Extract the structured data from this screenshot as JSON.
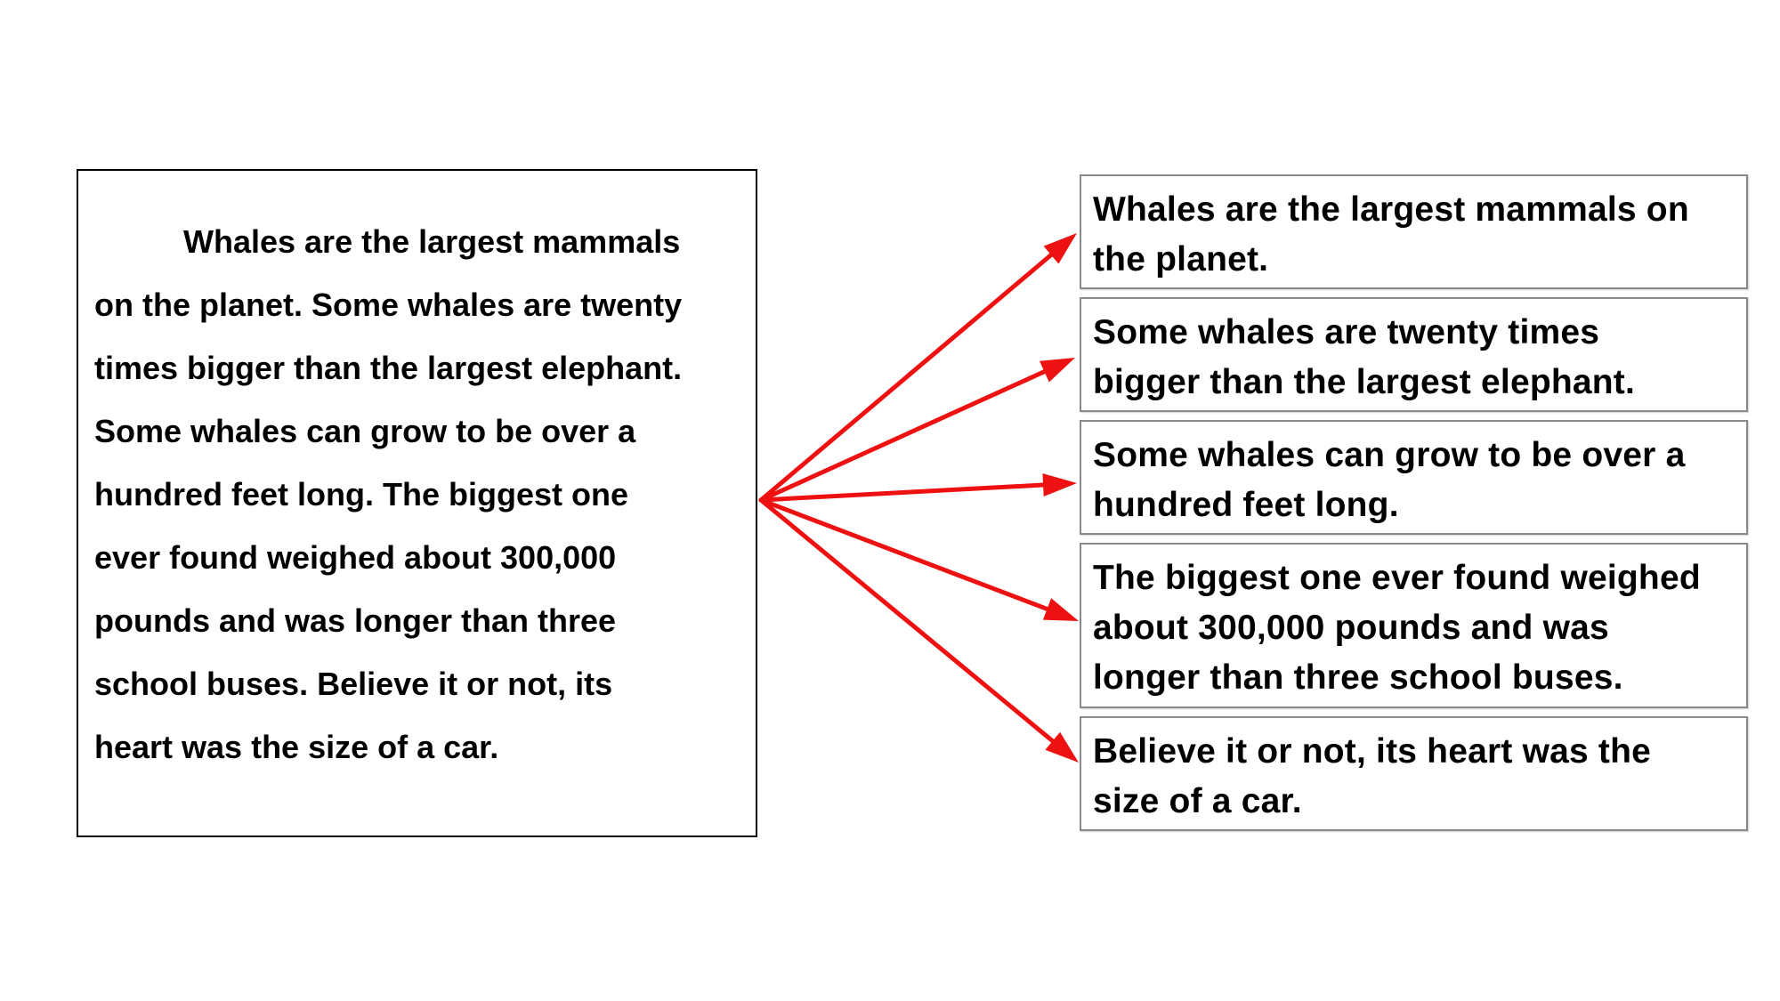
{
  "paragraph": {
    "lines": [
      "Whales are the largest mammals",
      "on the planet.  Some whales are twenty",
      "times bigger than the largest elephant.",
      "Some whales can grow to be over a",
      "hundred feet long.  The biggest one",
      "ever found weighed about 300,000",
      "pounds and was longer than three",
      "school buses.  Believe it or not, its",
      "heart was the size of a car."
    ]
  },
  "sentences": [
    {
      "lines": [
        "Whales are the largest mammals on",
        "the planet."
      ]
    },
    {
      "lines": [
        "Some whales are twenty times",
        "bigger than the largest elephant."
      ]
    },
    {
      "lines": [
        "Some whales can grow to be over a",
        "hundred feet long."
      ]
    },
    {
      "lines": [
        "The biggest one ever found weighed",
        "about 300,000 pounds and was",
        "longer than three school buses."
      ]
    },
    {
      "lines": [
        "Believe it or not, its heart was the",
        "size of a car."
      ]
    }
  ],
  "colors": {
    "arrow": "#ee1111",
    "paragraph_border": "#000000",
    "sentence_border": "#8a8a8a",
    "text": "#000000"
  }
}
